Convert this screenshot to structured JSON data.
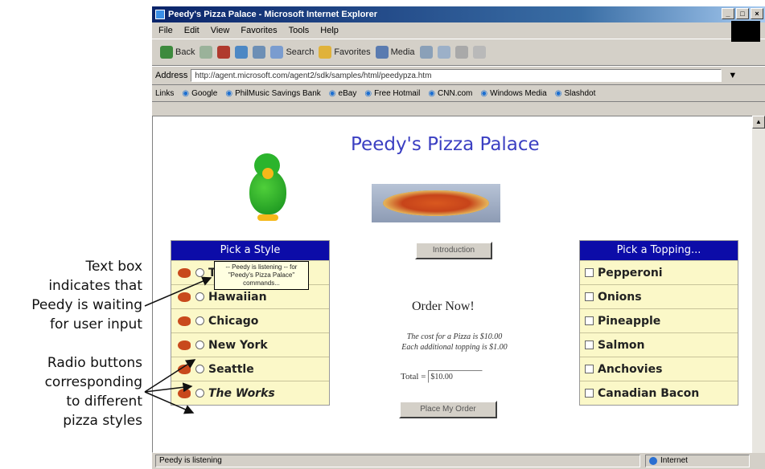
{
  "annotations": {
    "text_box": [
      "Text box",
      "indicates that",
      "Peedy is waiting",
      "for user input"
    ],
    "radio": [
      "Radio buttons",
      "corresponding",
      "to different",
      "pizza styles"
    ]
  },
  "window": {
    "title": "Peedy's Pizza Palace - Microsoft Internet Explorer",
    "menu": [
      "File",
      "Edit",
      "View",
      "Favorites",
      "Tools",
      "Help"
    ],
    "toolbar": [
      "Back",
      "Search",
      "Favorites",
      "Media"
    ],
    "address_label": "Address",
    "address_value": "http://agent.microsoft.com/agent2/sdk/samples/html/peedypza.htm",
    "links_label": "Links",
    "links": [
      "Google",
      "PhilMusic Savings Bank",
      "eBay",
      "Free Hotmail",
      "CNN.com",
      "Windows Media",
      "Slashdot"
    ],
    "status": "Peedy is listening",
    "zone": "Internet"
  },
  "page": {
    "title": "Peedy's Pizza Palace",
    "style_header": "Pick a Style",
    "styles": [
      "Thin",
      "Hawaiian",
      "Chicago",
      "New York",
      "Seattle",
      "The Works"
    ],
    "topping_header": "Pick a Topping...",
    "toppings": [
      "Pepperoni",
      "Onions",
      "Pineapple",
      "Salmon",
      "Anchovies",
      "Canadian Bacon"
    ],
    "introduction": "Introduction",
    "order_now": "Order Now!",
    "cost_line1": "The cost for a Pizza is $10.00",
    "cost_line2": "Each additional topping is $1.00",
    "total_label": "Total =",
    "total_value": "$10.00",
    "place_order": "Place My Order",
    "tooltip": "-- Peedy is listening -- for \"Peedy's Pizza Palace\" commands..."
  }
}
